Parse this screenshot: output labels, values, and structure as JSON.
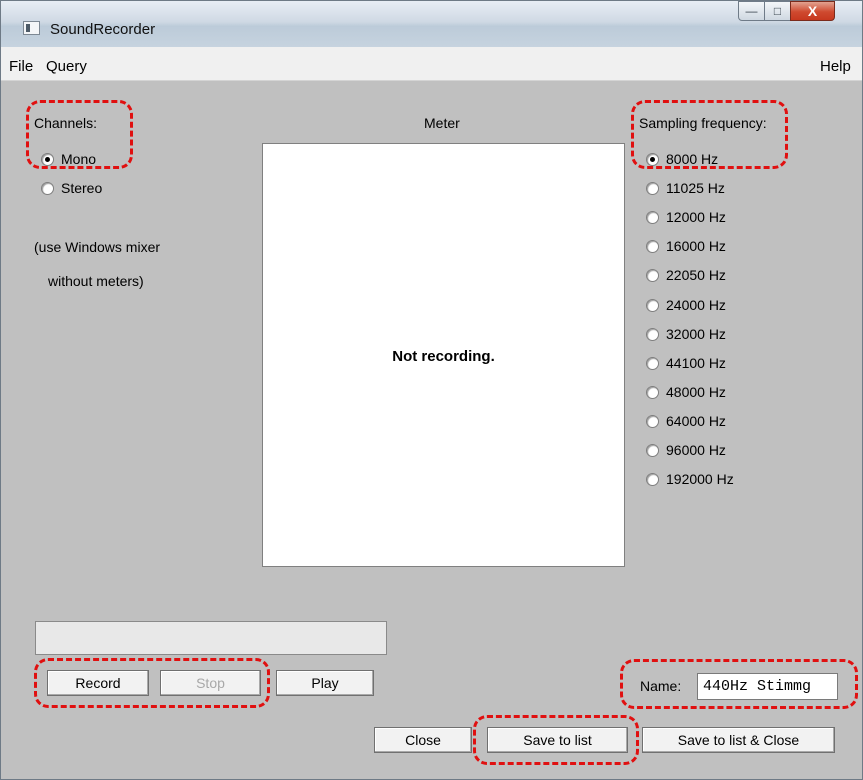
{
  "window": {
    "title": "SoundRecorder",
    "controls": {
      "minimize": "—",
      "maximize": "□",
      "close": "X"
    }
  },
  "menu": {
    "file": "File",
    "query": "Query",
    "help": "Help"
  },
  "channels": {
    "label": "Channels:",
    "options": [
      {
        "label": "Mono",
        "selected": true
      },
      {
        "label": "Stereo",
        "selected": false
      }
    ],
    "note_line1": "(use Windows mixer",
    "note_line2": "without meters)"
  },
  "meter": {
    "label": "Meter",
    "status": "Not recording."
  },
  "sampling": {
    "label": "Sampling frequency:",
    "options": [
      {
        "label": "8000 Hz",
        "selected": true
      },
      {
        "label": "11025 Hz",
        "selected": false
      },
      {
        "label": "12000 Hz",
        "selected": false
      },
      {
        "label": "16000 Hz",
        "selected": false
      },
      {
        "label": "22050 Hz",
        "selected": false
      },
      {
        "label": "24000 Hz",
        "selected": false
      },
      {
        "label": "32000 Hz",
        "selected": false
      },
      {
        "label": "44100 Hz",
        "selected": false
      },
      {
        "label": "48000 Hz",
        "selected": false
      },
      {
        "label": "64000 Hz",
        "selected": false
      },
      {
        "label": "96000 Hz",
        "selected": false
      },
      {
        "label": "192000 Hz",
        "selected": false
      }
    ]
  },
  "transport": {
    "record": "Record",
    "stop": "Stop",
    "play": "Play"
  },
  "name": {
    "label": "Name:",
    "value": "440Hz Stimmg"
  },
  "actions": {
    "close": "Close",
    "save": "Save to list",
    "save_close": "Save to list & Close"
  },
  "colors": {
    "window_bg": "#c0c0c0",
    "annotation": "#e01010"
  }
}
